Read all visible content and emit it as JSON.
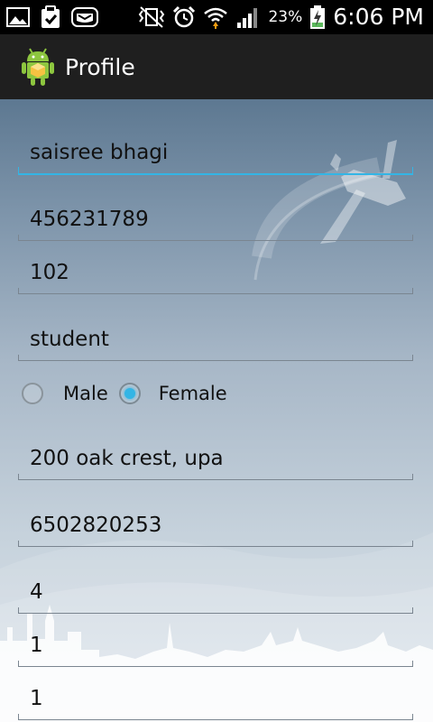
{
  "status_bar": {
    "time": "6:06 PM",
    "battery_percent": "23%",
    "icons": [
      "gallery-icon",
      "clipboard-check-icon",
      "mail-icon",
      "vibrate-mute-icon",
      "alarm-icon",
      "wifi-icon",
      "signal-icon",
      "battery-charging-icon"
    ]
  },
  "action_bar": {
    "title": "Profile",
    "icon": "android-app-icon"
  },
  "form": {
    "name": "saisree bhagi",
    "id_number": "456231789",
    "room": "102",
    "occupation": "student",
    "gender": {
      "male_label": "Male",
      "female_label": "Female",
      "selected": "Female"
    },
    "address": "200 oak crest, upa",
    "phone": "6502820253",
    "field_8": "4",
    "field_9": "1",
    "field_10": "1"
  },
  "colors": {
    "accent": "#33b5e5",
    "action_bar_bg": "#1f1f1f",
    "status_bar_bg": "#000000"
  }
}
